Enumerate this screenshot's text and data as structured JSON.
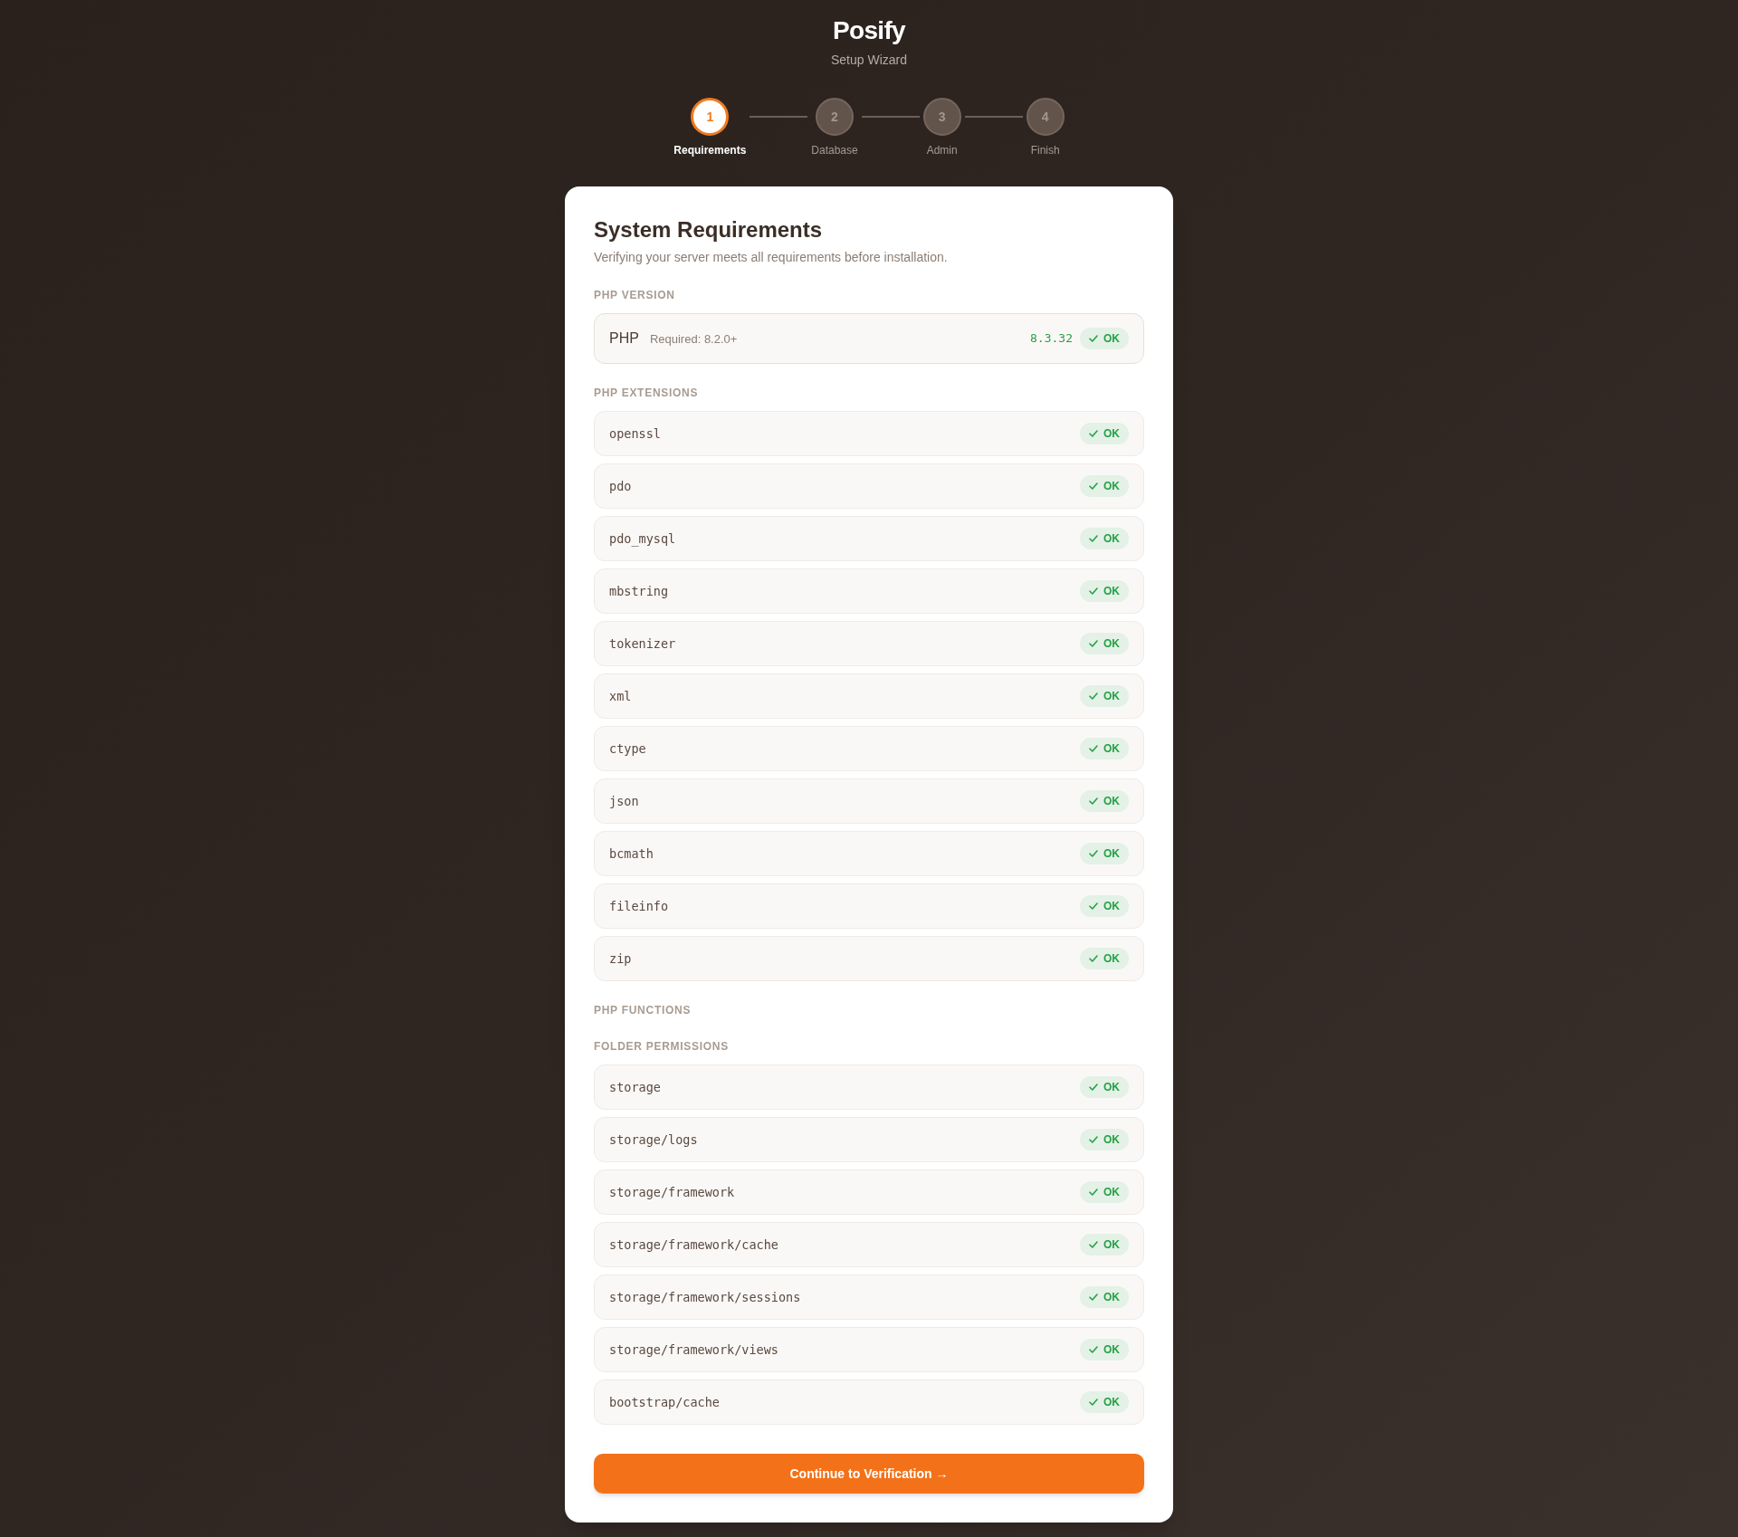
{
  "header": {
    "title": "Posify",
    "subtitle": "Setup Wizard"
  },
  "steps": [
    {
      "number": "1",
      "label": "Requirements",
      "selected": true
    },
    {
      "number": "2",
      "label": "Database",
      "selected": false
    },
    {
      "number": "3",
      "label": "Admin",
      "selected": false
    },
    {
      "number": "4",
      "label": "Finish",
      "selected": false
    }
  ],
  "card": {
    "title": "System Requirements",
    "subtitle": "Verifying your server meets all requirements before installation.",
    "sections": [
      {
        "kind": "version",
        "heading": "PHP VERSION",
        "items": [
          {
            "name": "PHP",
            "required": "Required: 8.2.0+",
            "version": "8.3.32",
            "status": "OK",
            "passed": true
          }
        ]
      },
      {
        "kind": "list",
        "heading": "PHP EXTENSIONS",
        "items": [
          {
            "name": "openssl",
            "status": "OK",
            "passed": true
          },
          {
            "name": "pdo",
            "status": "OK",
            "passed": true
          },
          {
            "name": "pdo_mysql",
            "status": "OK",
            "passed": true
          },
          {
            "name": "mbstring",
            "status": "OK",
            "passed": true
          },
          {
            "name": "tokenizer",
            "status": "OK",
            "passed": true
          },
          {
            "name": "xml",
            "status": "OK",
            "passed": true
          },
          {
            "name": "ctype",
            "status": "OK",
            "passed": true
          },
          {
            "name": "json",
            "status": "OK",
            "passed": true
          },
          {
            "name": "bcmath",
            "status": "OK",
            "passed": true
          },
          {
            "name": "fileinfo",
            "status": "OK",
            "passed": true
          },
          {
            "name": "zip",
            "status": "OK",
            "passed": true
          }
        ]
      },
      {
        "kind": "list",
        "heading": "PHP FUNCTIONS"
      },
      {
        "kind": "list",
        "heading": "FOLDER PERMISSIONS",
        "items": [
          {
            "name": "storage",
            "status": "OK",
            "passed": true
          },
          {
            "name": "storage/logs",
            "status": "OK",
            "passed": true
          },
          {
            "name": "storage/framework",
            "status": "OK",
            "passed": true
          },
          {
            "name": "storage/framework/cache",
            "status": "OK",
            "passed": true
          },
          {
            "name": "storage/framework/sessions",
            "status": "OK",
            "passed": true
          },
          {
            "name": "storage/framework/views",
            "status": "OK",
            "passed": true
          },
          {
            "name": "bootstrap/cache",
            "status": "OK",
            "passed": true
          }
        ]
      }
    ],
    "button": {
      "label": "Continue to Verification →"
    }
  }
}
